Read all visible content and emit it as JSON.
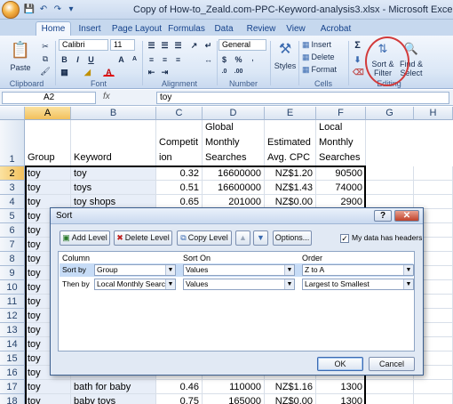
{
  "window": {
    "title": "Copy of How-to_Zeald.com-PPC-Keyword-analysis3.xlsx - Microsoft Excel"
  },
  "tabs": [
    "Home",
    "Insert",
    "Page Layout",
    "Formulas",
    "Data",
    "Review",
    "View",
    "Acrobat"
  ],
  "ribbon": {
    "paste": "Paste",
    "font_name": "Calibri",
    "font_size": "11",
    "number_format": "General",
    "styles": "Styles",
    "insert": "Insert",
    "delete": "Delete",
    "format": "Format",
    "sort_filter": "Sort & Filter",
    "find_select": "Find & Select",
    "groups": {
      "clipboard": "Clipboard",
      "font": "Font",
      "alignment": "Alignment",
      "number": "Number",
      "cells": "Cells",
      "editing": "Editing"
    },
    "accent": "#d23a3a"
  },
  "formula_bar": {
    "name_box": "A2",
    "fx": "fx",
    "content": "toy"
  },
  "columns": [
    "A",
    "B",
    "C",
    "D",
    "E",
    "F",
    "G",
    "H"
  ],
  "headers": {
    "a": "Group",
    "b": "Keyword",
    "c": "Competit ion",
    "d": "Global Monthly Searches",
    "e": "Estimated Avg. CPC",
    "f": "Local Monthly Searches"
  },
  "rows": [
    {
      "n": "2",
      "a": "toy",
      "b": "toy",
      "c": "0.32",
      "d": "16600000",
      "e": "NZ$1.20",
      "f": "90500"
    },
    {
      "n": "3",
      "a": "toy",
      "b": "toys",
      "c": "0.51",
      "d": "16600000",
      "e": "NZ$1.43",
      "f": "74000"
    },
    {
      "n": "4",
      "a": "toy",
      "b": "toy shops",
      "c": "0.65",
      "d": "201000",
      "e": "NZ$0.00",
      "f": "2900"
    },
    {
      "n": "5",
      "a": "toy",
      "b": "",
      "c": "",
      "d": "",
      "e": "",
      "f": ""
    },
    {
      "n": "6",
      "a": "toy",
      "b": "",
      "c": "",
      "d": "",
      "e": "",
      "f": ""
    },
    {
      "n": "7",
      "a": "toy",
      "b": "",
      "c": "",
      "d": "",
      "e": "",
      "f": ""
    },
    {
      "n": "8",
      "a": "toy",
      "b": "",
      "c": "",
      "d": "",
      "e": "",
      "f": ""
    },
    {
      "n": "9",
      "a": "toy",
      "b": "",
      "c": "",
      "d": "",
      "e": "",
      "f": ""
    },
    {
      "n": "10",
      "a": "toy",
      "b": "",
      "c": "",
      "d": "",
      "e": "",
      "f": ""
    },
    {
      "n": "11",
      "a": "toy",
      "b": "",
      "c": "",
      "d": "",
      "e": "",
      "f": ""
    },
    {
      "n": "12",
      "a": "toy",
      "b": "",
      "c": "",
      "d": "",
      "e": "",
      "f": ""
    },
    {
      "n": "13",
      "a": "toy",
      "b": "",
      "c": "",
      "d": "",
      "e": "",
      "f": ""
    },
    {
      "n": "14",
      "a": "toy",
      "b": "",
      "c": "",
      "d": "",
      "e": "",
      "f": ""
    },
    {
      "n": "15",
      "a": "toy",
      "b": "",
      "c": "",
      "d": "",
      "e": "",
      "f": ""
    },
    {
      "n": "16",
      "a": "toy",
      "b": "",
      "c": "",
      "d": "",
      "e": "",
      "f": ""
    },
    {
      "n": "17",
      "a": "toy",
      "b": "bath for baby",
      "c": "0.46",
      "d": "110000",
      "e": "NZ$1.16",
      "f": "1300"
    },
    {
      "n": "18",
      "a": "toy",
      "b": "baby toys",
      "c": "0.75",
      "d": "165000",
      "e": "NZ$0.00",
      "f": "1300"
    }
  ],
  "dialog": {
    "title": "Sort",
    "add_level": "Add Level",
    "delete_level": "Delete Level",
    "copy_level": "Copy Level",
    "options": "Options...",
    "has_headers": "My data has headers",
    "col_column": "Column",
    "col_sort_on": "Sort On",
    "col_order": "Order",
    "levels": [
      {
        "label": "Sort by",
        "column": "Group",
        "sort_on": "Values",
        "order": "Z to A"
      },
      {
        "label": "Then by",
        "column": "Local Monthly Searches",
        "sort_on": "Values",
        "order": "Largest to Smallest"
      }
    ],
    "ok": "OK",
    "cancel": "Cancel"
  }
}
